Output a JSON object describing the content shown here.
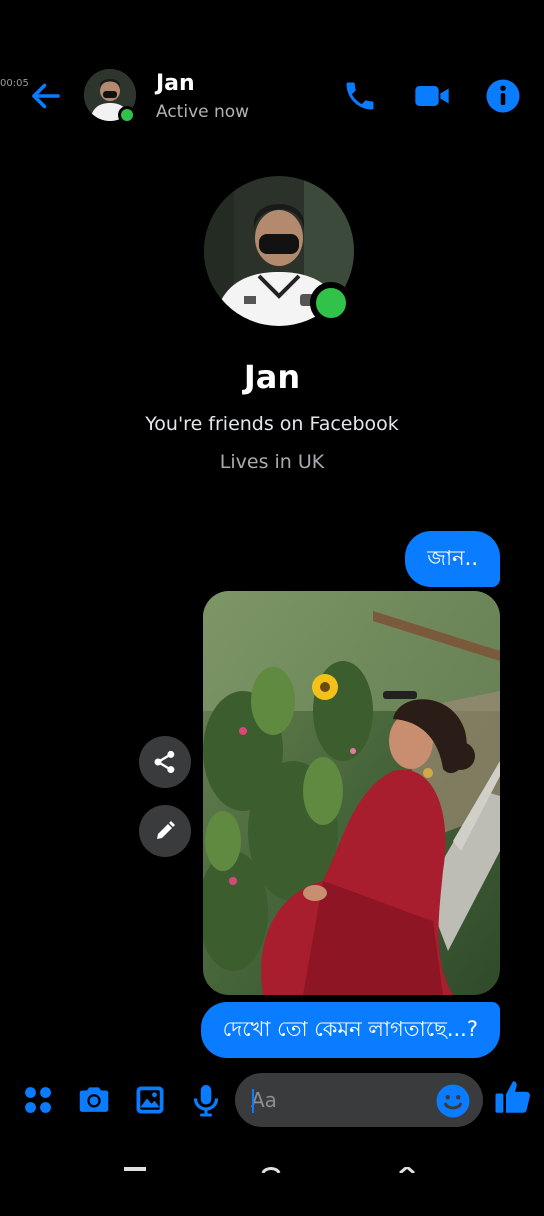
{
  "status": {
    "time": "00:05"
  },
  "header": {
    "name": "Jan",
    "status": "Active now",
    "icons": [
      "back-arrow-icon",
      "phone-icon",
      "video-camera-icon",
      "info-icon"
    ]
  },
  "profile": {
    "name": "Jan",
    "relation": "You're friends on Facebook",
    "location": "Lives in UK"
  },
  "messages": [
    {
      "type": "text",
      "from": "me",
      "text": "জান.."
    },
    {
      "type": "photo",
      "from": "me",
      "subject": "woman in red dress seated on a bench in a garden"
    },
    {
      "type": "text",
      "from": "me",
      "text": "দেখো তো কেমন লাগতাছে...?"
    }
  ],
  "composer": {
    "placeholder": "Aa",
    "icons": [
      "apps-grid-icon",
      "camera-icon",
      "gallery-icon",
      "microphone-icon",
      "emoji-icon",
      "thumbs-up-icon"
    ]
  },
  "colors": {
    "accent": "#0a7cff",
    "online": "#31c24a",
    "background": "#000000",
    "input": "#3a3b3c"
  }
}
